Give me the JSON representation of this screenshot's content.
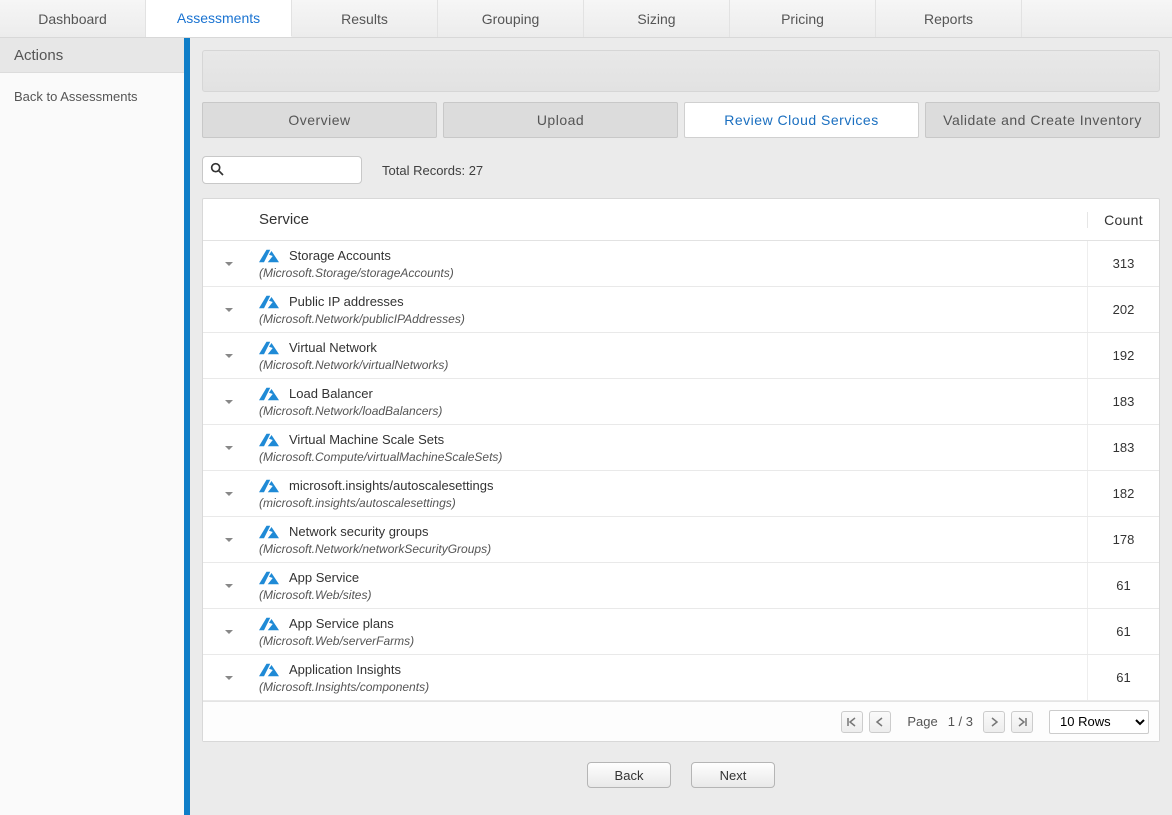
{
  "nav": {
    "tabs": [
      "Dashboard",
      "Assessments",
      "Results",
      "Grouping",
      "Sizing",
      "Pricing",
      "Reports"
    ],
    "active_index": 1
  },
  "sidebar": {
    "header": "Actions",
    "back_link": "Back to Assessments"
  },
  "subtabs": {
    "items": [
      "Overview",
      "Upload",
      "Review Cloud Services",
      "Validate and Create Inventory"
    ],
    "active_index": 2
  },
  "search": {
    "value": "",
    "placeholder": ""
  },
  "records_label": "Total Records: 27",
  "grid": {
    "headers": {
      "service": "Service",
      "count": "Count"
    },
    "rows": [
      {
        "name": "Storage Accounts",
        "type": "(Microsoft.Storage/storageAccounts)",
        "count": 313
      },
      {
        "name": "Public IP addresses",
        "type": "(Microsoft.Network/publicIPAddresses)",
        "count": 202
      },
      {
        "name": "Virtual Network",
        "type": "(Microsoft.Network/virtualNetworks)",
        "count": 192
      },
      {
        "name": "Load Balancer",
        "type": "(Microsoft.Network/loadBalancers)",
        "count": 183
      },
      {
        "name": "Virtual Machine Scale Sets",
        "type": "(Microsoft.Compute/virtualMachineScaleSets)",
        "count": 183
      },
      {
        "name": "microsoft.insights/autoscalesettings",
        "type": "(microsoft.insights/autoscalesettings)",
        "count": 182
      },
      {
        "name": "Network security groups",
        "type": "(Microsoft.Network/networkSecurityGroups)",
        "count": 178
      },
      {
        "name": "App Service",
        "type": "(Microsoft.Web/sites)",
        "count": 61
      },
      {
        "name": "App Service plans",
        "type": "(Microsoft.Web/serverFarms)",
        "count": 61
      },
      {
        "name": "Application Insights",
        "type": "(Microsoft.Insights/components)",
        "count": 61
      }
    ]
  },
  "pager": {
    "label": "Page",
    "current": "1 / 3",
    "rows_select": "10 Rows"
  },
  "buttons": {
    "back": "Back",
    "next": "Next"
  }
}
